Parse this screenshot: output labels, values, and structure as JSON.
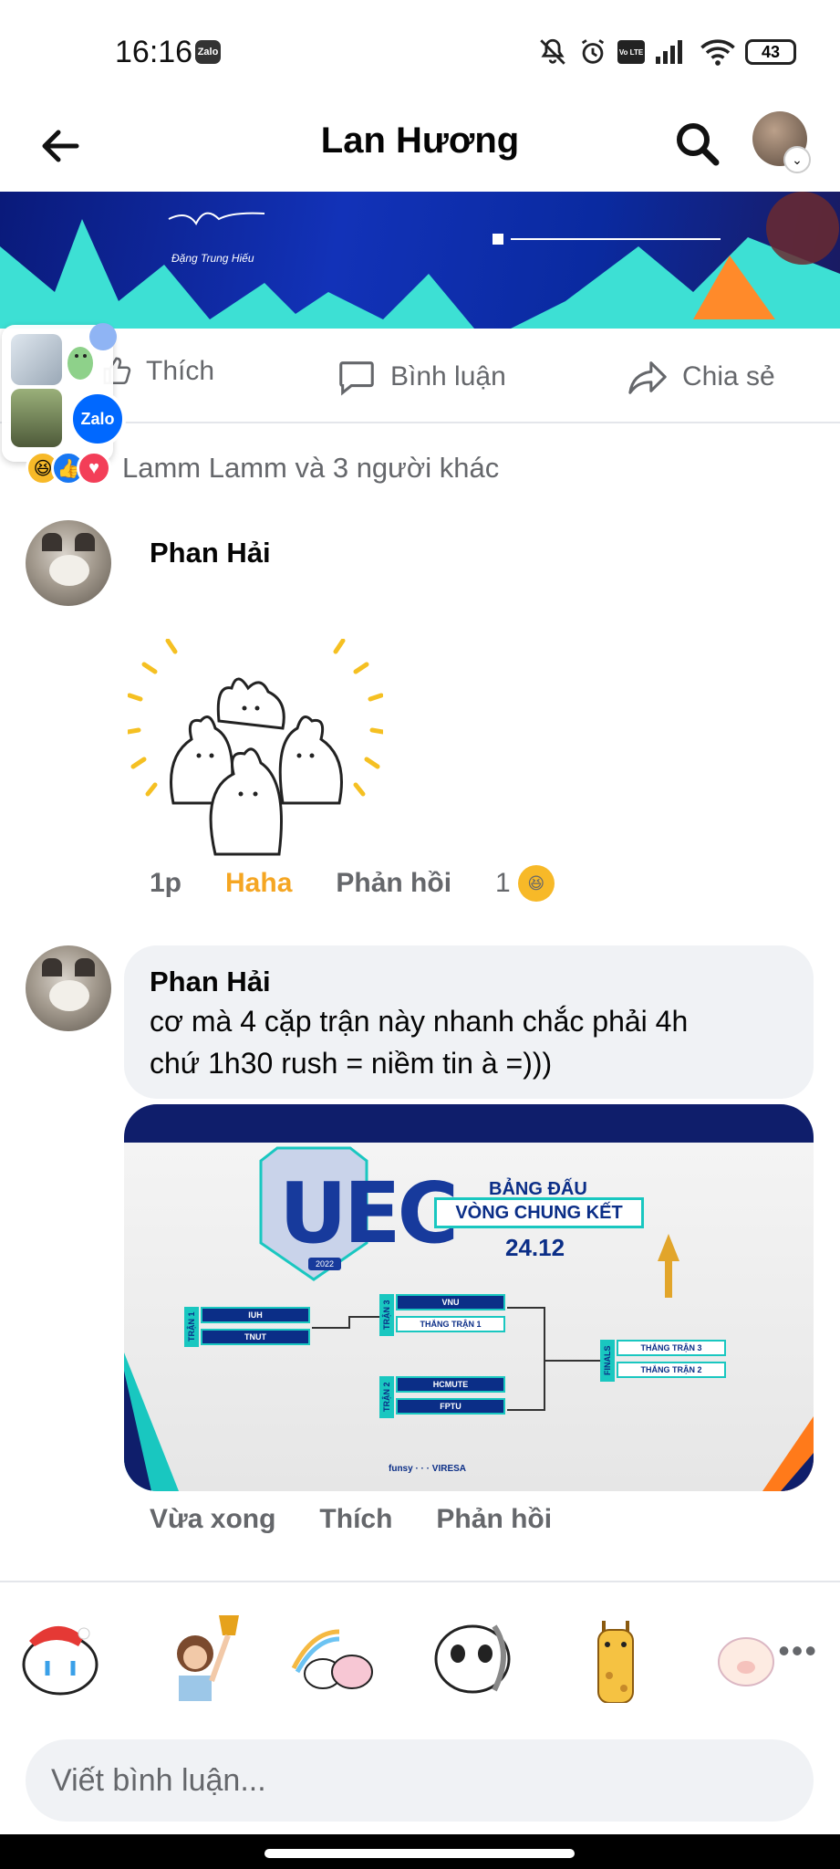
{
  "status_bar": {
    "time": "16:16",
    "app_badge": "Zalo",
    "volte": "Vo LTE",
    "battery": "43"
  },
  "header": {
    "title": "Lan Hương"
  },
  "banner": {
    "signature_name": "Đặng Trung Hiếu"
  },
  "floating_app": {
    "label": "Zalo"
  },
  "actions": {
    "like": "Thích",
    "comment": "Bình luận",
    "share": "Chia sẻ"
  },
  "reactions": {
    "summary": "Lamm Lamm và 3 người khác"
  },
  "comments": [
    {
      "author": "Phan Hải",
      "time": "1p",
      "reaction_label": "Haha",
      "reply": "Phản hồi",
      "reaction_count": "1"
    },
    {
      "author": "Phan Hải",
      "text_line1": "cơ mà 4 cặp trận này nhanh chắc phải 4h",
      "text_line2": "chứ 1h30 rush = niềm tin à =)))",
      "time": "Vừa xong",
      "like": "Thích",
      "reply": "Phản hồi"
    }
  ],
  "attachment": {
    "logo": "UEC",
    "logo_sub": "2022",
    "title_top": "BẢNG ĐẤU",
    "title_mid": "VÒNG CHUNG KẾT",
    "date": "24.12",
    "round1_label": "TRẬN 1",
    "round2_label": "TRẬN 2",
    "round3_label": "TRẬN 3",
    "finals_label": "FINALS",
    "r1_team1": "IUH",
    "r1_team2": "TNUT",
    "r3_team1": "VNU",
    "r3_team2": "THẮNG TRẬN 1",
    "r2_team1": "HCMUTE",
    "r2_team2": "FPTU",
    "final_slot1": "THẮNG TRẬN 3",
    "final_slot2": "THẮNG TRẬN 2",
    "sponsors": "funsy · · · VIRESA"
  },
  "composer": {
    "placeholder": "Viết bình luận..."
  }
}
